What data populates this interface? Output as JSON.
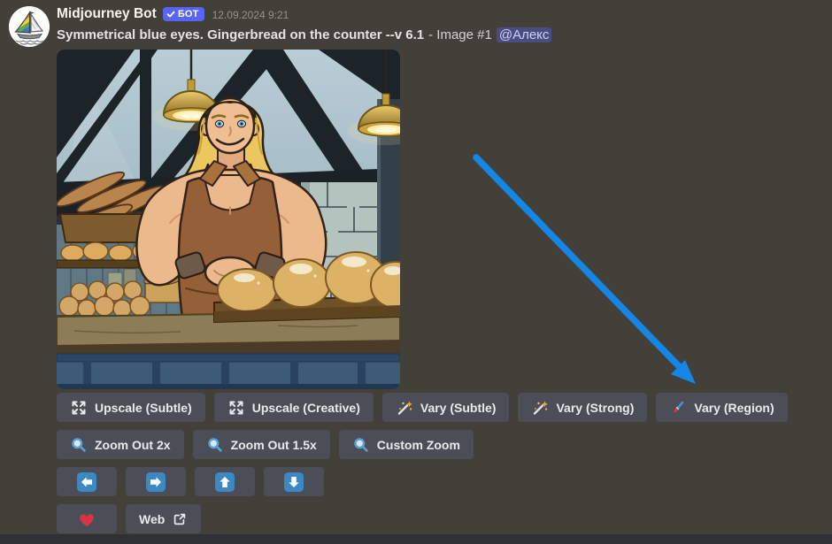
{
  "message": {
    "author": "Midjourney Bot",
    "badge_label": "БОТ",
    "badge_icon": "check-icon",
    "timestamp": "12.09.2024 9:21",
    "prompt_bold": "Symmetrical blue eyes. Gingerbread on the counter --v 6.1",
    "prompt_suffix": "- Image #1",
    "mention": "@Алекс",
    "image_description": "Comic-style blond muscular baker smiling behind a bakery counter with bread loaves, hanging brass lamps, timber beams and a stone wall"
  },
  "actions": {
    "row1": [
      {
        "icon": "upscale-icon",
        "label": "Upscale (Subtle)"
      },
      {
        "icon": "upscale-icon",
        "label": "Upscale (Creative)"
      },
      {
        "icon": "magic-wand-icon",
        "label": "Vary (Subtle)"
      },
      {
        "icon": "magic-wand-icon",
        "label": "Vary (Strong)"
      },
      {
        "icon": "paintbrush-icon",
        "label": "Vary (Region)"
      }
    ],
    "row2": [
      {
        "icon": "magnifier-icon",
        "label": "Zoom Out 2x"
      },
      {
        "icon": "magnifier-icon",
        "label": "Zoom Out 1.5x"
      },
      {
        "icon": "magnifier-icon",
        "label": "Custom Zoom"
      }
    ],
    "row3": [
      {
        "icon": "arrow-left-icon"
      },
      {
        "icon": "arrow-right-icon"
      },
      {
        "icon": "arrow-up-icon"
      },
      {
        "icon": "arrow-down-icon"
      }
    ],
    "row4": [
      {
        "icon": "heart-icon"
      },
      {
        "icon": "external-link-icon",
        "label": "Web"
      }
    ]
  },
  "annotation": {
    "type": "arrow",
    "color": "#1487e6",
    "points_to": "Vary (Region)"
  },
  "colors": {
    "background": "#433f39",
    "button_bg": "#4b4e56",
    "badge_blue": "#5865f2",
    "mention_text": "#ccd1fb",
    "arrow_annotation_blue": "#1487e6",
    "bottom_bar": "#2e3136",
    "heart_red": "#dd3146",
    "emoji_arrow_blue": "#3b88c3"
  }
}
